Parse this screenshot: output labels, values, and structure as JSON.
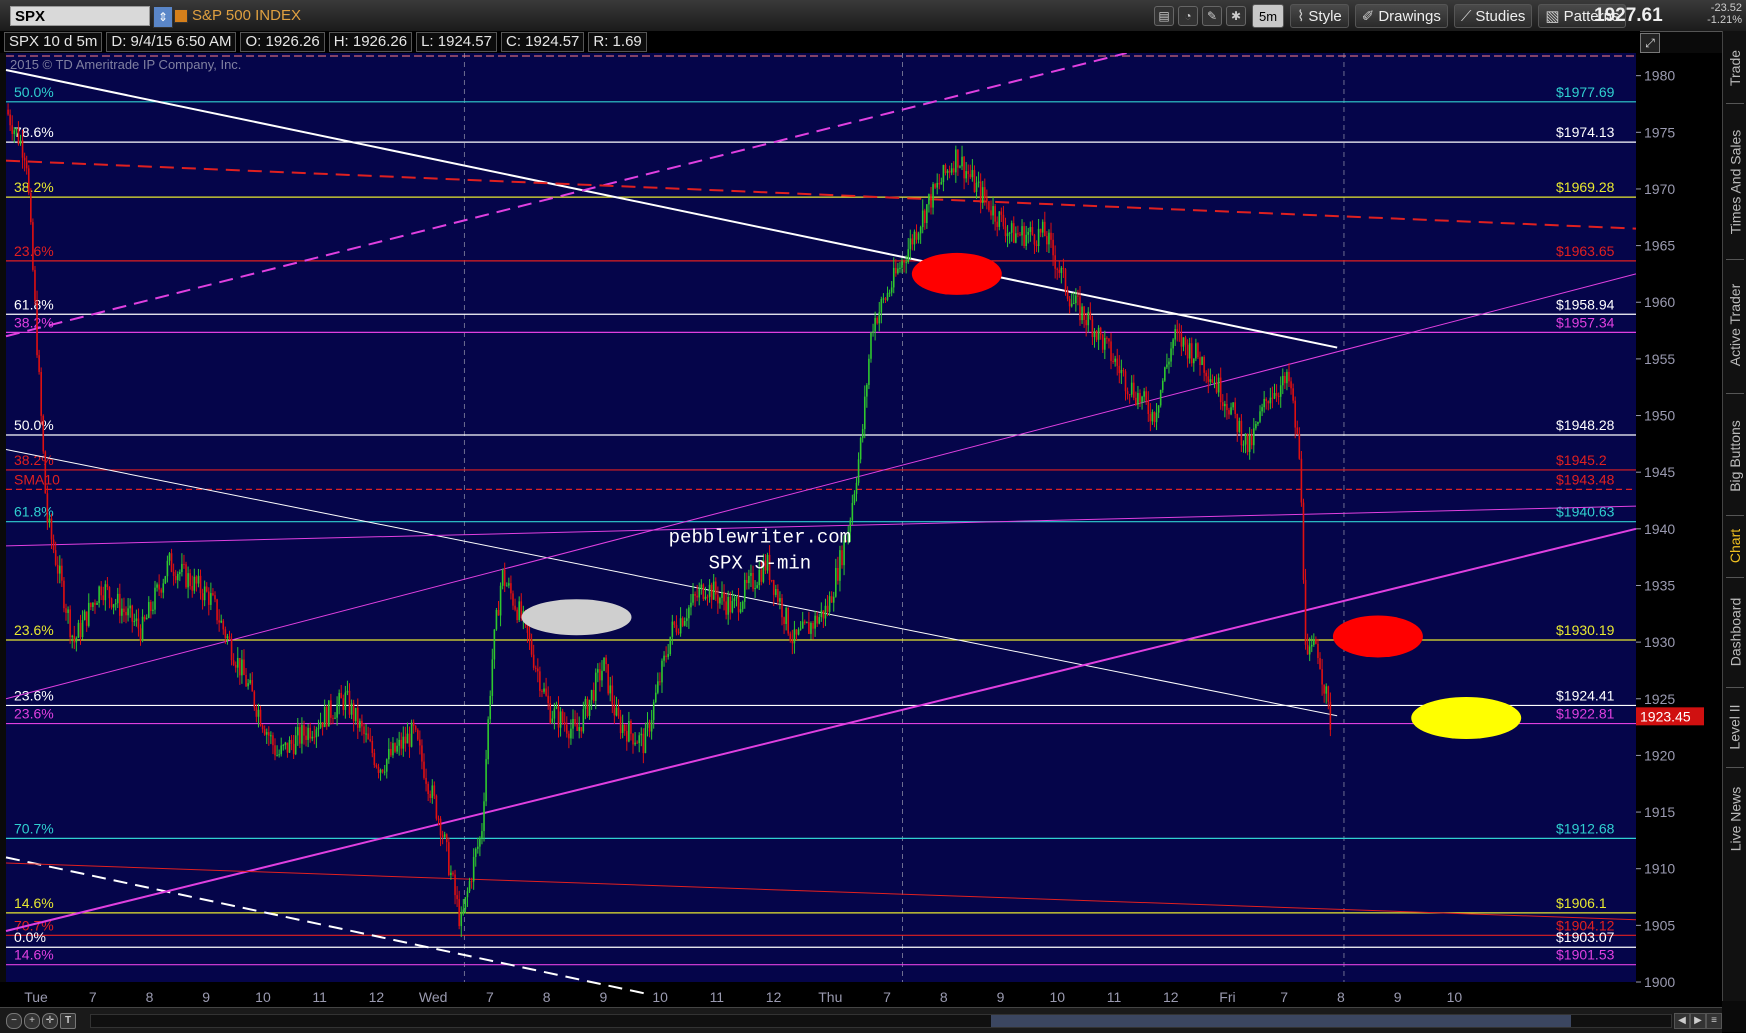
{
  "toolbar": {
    "symbol": "SPX",
    "symbol_name": "S&P 500 INDEX",
    "period_button": "5m",
    "style_label": "Style",
    "drawings_label": "Drawings",
    "studies_label": "Studies",
    "patterns_label": "Patterns",
    "last_price": "1927.61",
    "change_abs": "-23.52",
    "change_pct": "-1.21%"
  },
  "info_bar": {
    "chart_spec": "SPX 10 d 5m",
    "datetime": "D: 9/4/15 6:50 AM",
    "open": "O: 1926.26",
    "high": "H: 1926.26",
    "low": "L: 1924.57",
    "close": "C: 1924.57",
    "range": "R: 1.69"
  },
  "copyright": "2015 © TD Ameritrade IP Company, Inc.",
  "watermark": [
    "pebblewriter.com",
    "SPX 5-min"
  ],
  "sidebar_tabs": [
    "Trade",
    "Times And Sales",
    "Active Trader",
    "Big Buttons",
    "Chart",
    "Dashboard",
    "Level II",
    "Live News"
  ],
  "colors": {
    "background": "#05054a",
    "up_candle": "#2fc82f",
    "down_candle": "#e01010",
    "white_level": "#ffffff",
    "yellow_level": "#e8e830",
    "red_level": "#e02020",
    "magenta_level": "#e040e0",
    "cyan_level": "#30d0d0",
    "price_tag": "#d01010"
  },
  "chart_data": {
    "type": "candlestick",
    "symbol": "SPX",
    "interval": "5m",
    "ylim": [
      1900,
      1982
    ],
    "y_ticks": [
      1900,
      1905,
      1910,
      1915,
      1920,
      1925,
      1930,
      1935,
      1940,
      1945,
      1950,
      1955,
      1960,
      1965,
      1970,
      1975,
      1980
    ],
    "x_tick_labels": [
      "Tue",
      "7",
      "8",
      "9",
      "10",
      "11",
      "12",
      "Wed",
      "7",
      "8",
      "9",
      "10",
      "11",
      "12",
      "Thu",
      "7",
      "8",
      "9",
      "10",
      "11",
      "12",
      "Fri",
      "7",
      "8",
      "9",
      "10"
    ],
    "last_price_tag": "1923.45",
    "price_path": [
      [
        0,
        1977
      ],
      [
        0.3,
        1973
      ],
      [
        0.6,
        1941
      ],
      [
        1.0,
        1930
      ],
      [
        1.4,
        1935
      ],
      [
        2.0,
        1931
      ],
      [
        2.4,
        1937
      ],
      [
        3.0,
        1934
      ],
      [
        3.5,
        1927
      ],
      [
        4.0,
        1920
      ],
      [
        4.4,
        1922
      ],
      [
        5.0,
        1925
      ],
      [
        5.5,
        1919
      ],
      [
        6.0,
        1922
      ],
      [
        6.4,
        1914
      ],
      [
        6.7,
        1905
      ],
      [
        6.9,
        1911
      ],
      [
        7.0,
        1913
      ],
      [
        7.15,
        1928
      ],
      [
        7.3,
        1936
      ],
      [
        7.6,
        1932
      ],
      [
        8.0,
        1924
      ],
      [
        8.4,
        1922
      ],
      [
        8.8,
        1928
      ],
      [
        9.0,
        1923
      ],
      [
        9.4,
        1921
      ],
      [
        9.8,
        1931
      ],
      [
        10.3,
        1935
      ],
      [
        10.7,
        1933
      ],
      [
        11.2,
        1937
      ],
      [
        11.6,
        1930
      ],
      [
        12.1,
        1933
      ],
      [
        12.4,
        1940
      ],
      [
        12.6,
        1948
      ],
      [
        12.75,
        1958
      ],
      [
        13.0,
        1961
      ],
      [
        13.3,
        1965
      ],
      [
        13.6,
        1969
      ],
      [
        14.0,
        1973
      ],
      [
        14.3,
        1970
      ],
      [
        14.8,
        1966
      ],
      [
        15.3,
        1966
      ],
      [
        15.7,
        1960
      ],
      [
        16.0,
        1958
      ],
      [
        16.5,
        1953
      ],
      [
        16.9,
        1950
      ],
      [
        17.2,
        1957
      ],
      [
        17.6,
        1955
      ],
      [
        18.0,
        1951
      ],
      [
        18.3,
        1947
      ],
      [
        18.6,
        1952
      ],
      [
        18.9,
        1953
      ],
      [
        19.05,
        1946
      ],
      [
        19.15,
        1928
      ],
      [
        19.3,
        1930
      ],
      [
        19.5,
        1923
      ]
    ],
    "levels": [
      {
        "label": "50.0%",
        "price_label": "$1977.69",
        "value": 1977.69,
        "color": "cyan"
      },
      {
        "label": "78.6%",
        "price_label": "$1974.13",
        "value": 1974.13,
        "color": "white"
      },
      {
        "label": "38.2%",
        "price_label": "$1969.28",
        "value": 1969.28,
        "color": "yellow"
      },
      {
        "label": "23.6%",
        "price_label": "$1963.65",
        "value": 1963.65,
        "color": "red"
      },
      {
        "label": "61.8%",
        "price_label": "$1958.94",
        "value": 1958.94,
        "color": "white"
      },
      {
        "label": "38.2%",
        "price_label": "$1957.34",
        "value": 1957.34,
        "color": "magenta"
      },
      {
        "label": "50.0%",
        "price_label": "$1948.28",
        "value": 1948.28,
        "color": "white"
      },
      {
        "label": "38.2%",
        "price_label": "$1945.2",
        "value": 1945.2,
        "color": "red"
      },
      {
        "label": "SMA10",
        "price_label": "$1943.48",
        "value": 1943.48,
        "color": "red_dashed"
      },
      {
        "label": "61.8%",
        "price_label": "$1940.63",
        "value": 1940.63,
        "color": "cyan"
      },
      {
        "label": "23.6%",
        "price_label": "$1930.19",
        "value": 1930.19,
        "color": "yellow"
      },
      {
        "label": "23.6%",
        "price_label": "$1924.41",
        "value": 1924.41,
        "color": "white"
      },
      {
        "label": "23.6%",
        "price_label": "$1922.81",
        "value": 1922.81,
        "color": "magenta"
      },
      {
        "label": "70.7%",
        "price_label": "$1912.68",
        "value": 1912.68,
        "color": "cyan"
      },
      {
        "label": "14.6%",
        "price_label": "$1906.1",
        "value": 1906.1,
        "color": "yellow"
      },
      {
        "label": "70.7%",
        "price_label": "$1904.12",
        "value": 1904.12,
        "color": "red"
      },
      {
        "label": "0.0%",
        "price_label": "$1903.07",
        "value": 1903.07,
        "color": "white"
      },
      {
        "label": "14.6%",
        "price_label": "$1901.53",
        "value": 1901.53,
        "color": "magenta"
      }
    ],
    "trendlines": [
      {
        "color": "white",
        "style": "solid",
        "from": [
          0,
          1980.5
        ],
        "to": [
          19.6,
          1956
        ]
      },
      {
        "color": "white",
        "style": "thin",
        "from": [
          0,
          1947
        ],
        "to": [
          19.6,
          1923.5
        ]
      },
      {
        "color": "white",
        "style": "dashed",
        "from": [
          0,
          1911
        ],
        "to": [
          9.4,
          1899
        ]
      },
      {
        "color": "magenta",
        "style": "solid",
        "from": [
          0,
          1904.5
        ],
        "to": [
          24,
          1940
        ]
      },
      {
        "color": "magenta",
        "style": "thin",
        "from": [
          0,
          1925
        ],
        "to": [
          24,
          1962.5
        ]
      },
      {
        "color": "magenta",
        "style": "thin",
        "from": [
          0,
          1938.5
        ],
        "to": [
          24,
          1942
        ]
      },
      {
        "color": "magenta",
        "style": "dashed",
        "from": [
          0,
          1957
        ],
        "to": [
          16.5,
          1982
        ]
      },
      {
        "color": "red",
        "style": "dashed",
        "from": [
          0,
          1972.5
        ],
        "to": [
          24,
          1966.5
        ]
      },
      {
        "color": "red",
        "style": "thin",
        "from": [
          0,
          1910.5
        ],
        "to": [
          24,
          1905.5
        ]
      }
    ],
    "markers": [
      {
        "color": "red",
        "x": 14.0,
        "y": 1962.5
      },
      {
        "color": "gray",
        "x": 8.4,
        "y": 1932.2
      },
      {
        "color": "red",
        "x": 20.2,
        "y": 1930.5
      },
      {
        "color": "yellow",
        "x": 21.5,
        "y": 1923.3
      }
    ],
    "session_breaks": [
      6.75,
      13.2,
      19.7
    ]
  }
}
